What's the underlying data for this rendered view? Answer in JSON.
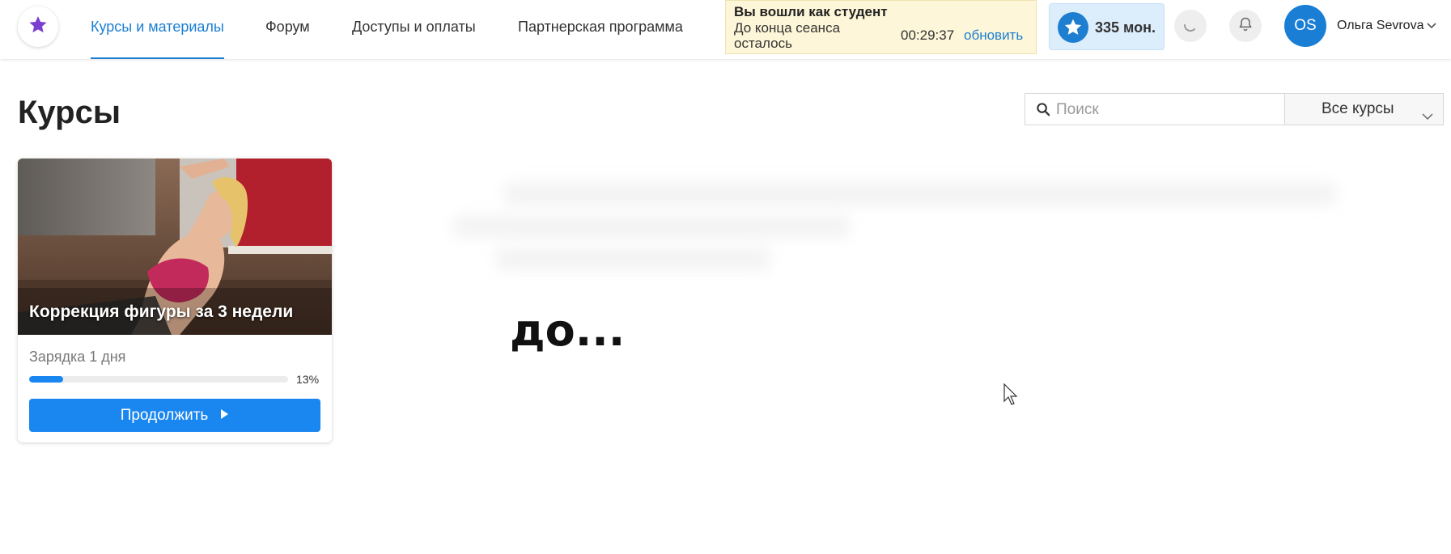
{
  "header": {
    "nav": [
      {
        "label": "Курсы и материалы",
        "active": true
      },
      {
        "label": "Форум",
        "active": false
      },
      {
        "label": "Доступы и оплаты",
        "active": false
      },
      {
        "label": "Партнерская программа",
        "active": false
      }
    ],
    "session": {
      "title": "Вы вошли как студент",
      "remaining_label": "До конца сеанса осталось",
      "timer": "00:29:37",
      "refresh_label": "обновить"
    },
    "coins": {
      "amount": "335 мон."
    },
    "user": {
      "initials": "OS",
      "name": "Ольга Sevrova"
    }
  },
  "main": {
    "title": "Курсы",
    "search": {
      "placeholder": "Поиск",
      "value": ""
    },
    "filter": {
      "selected": "Все курсы"
    },
    "courses": [
      {
        "title": "Коррекция фигуры за 3 недели",
        "lesson": "Зарядка 1 дня",
        "progress_percent": 13,
        "progress_label": "13%",
        "button_label": "Продолжить"
      }
    ]
  },
  "overlay": {
    "text": "до..."
  },
  "colors": {
    "accent": "#1a7fd4",
    "button": "#1a86f0",
    "session_bg": "#fdf6d8",
    "coins_bg": "#dcedfb",
    "logo_star": "#7a3fd0"
  },
  "icons": [
    "star-icon",
    "search-icon",
    "chevron-down-icon",
    "bell-icon",
    "spinner-icon",
    "play-icon",
    "cursor-icon"
  ]
}
